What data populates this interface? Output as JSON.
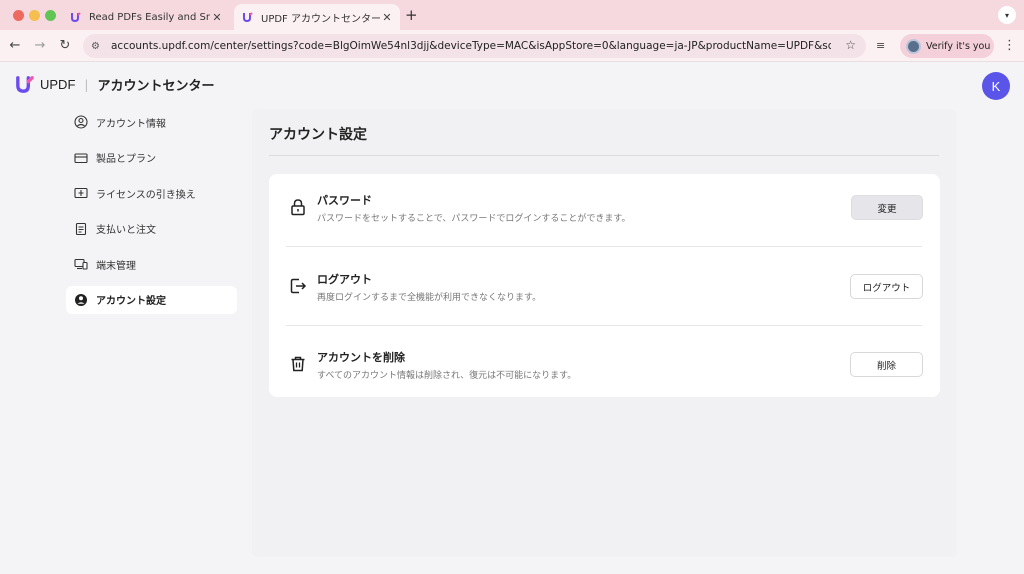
{
  "browser": {
    "tabs": [
      {
        "title": "Read PDFs Easily and Smartly",
        "active": false
      },
      {
        "title": "UPDF アカウントセンター",
        "active": true
      }
    ],
    "new_tab": "+",
    "url": "accounts.updf.com/center/settings?code=BlgOimWe54nl3djj&deviceType=MAC&isAppStore=0&language=ja-JP&productName=UPDF&schemeName=u...",
    "profile_label": "Verify it's you"
  },
  "header": {
    "brand": "UPDF",
    "section": "アカウントセンター",
    "avatar_initial": "K"
  },
  "sidebar": {
    "items": [
      {
        "label": "アカウント情報",
        "icon": "user-circle-icon",
        "active": false
      },
      {
        "label": "製品とプラン",
        "icon": "card-icon",
        "active": false
      },
      {
        "label": "ライセンスの引き換え",
        "icon": "license-icon",
        "active": false
      },
      {
        "label": "支払いと注文",
        "icon": "receipt-icon",
        "active": false
      },
      {
        "label": "端末管理",
        "icon": "devices-icon",
        "active": false
      },
      {
        "label": "アカウント設定",
        "icon": "user-settings-icon",
        "active": true
      }
    ]
  },
  "main": {
    "title": "アカウント設定",
    "rows": [
      {
        "title": "パスワード",
        "description": "パスワードをセットすることで、パスワードでログインすることができます。",
        "button": "変更",
        "icon": "lock-icon"
      },
      {
        "title": "ログアウト",
        "description": "再度ログインするまで全機能が利用できなくなります。",
        "button": "ログアウト",
        "icon": "logout-icon"
      },
      {
        "title": "アカウントを削除",
        "description": "すべてのアカウント情報は削除され、復元は不可能になります。",
        "button": "削除",
        "icon": "trash-icon"
      }
    ]
  },
  "colors": {
    "tab_bar": "#f6d9df",
    "toolbar": "#fbf1f3",
    "avatar": "#5a55e8",
    "background": "#f4f3f6"
  }
}
